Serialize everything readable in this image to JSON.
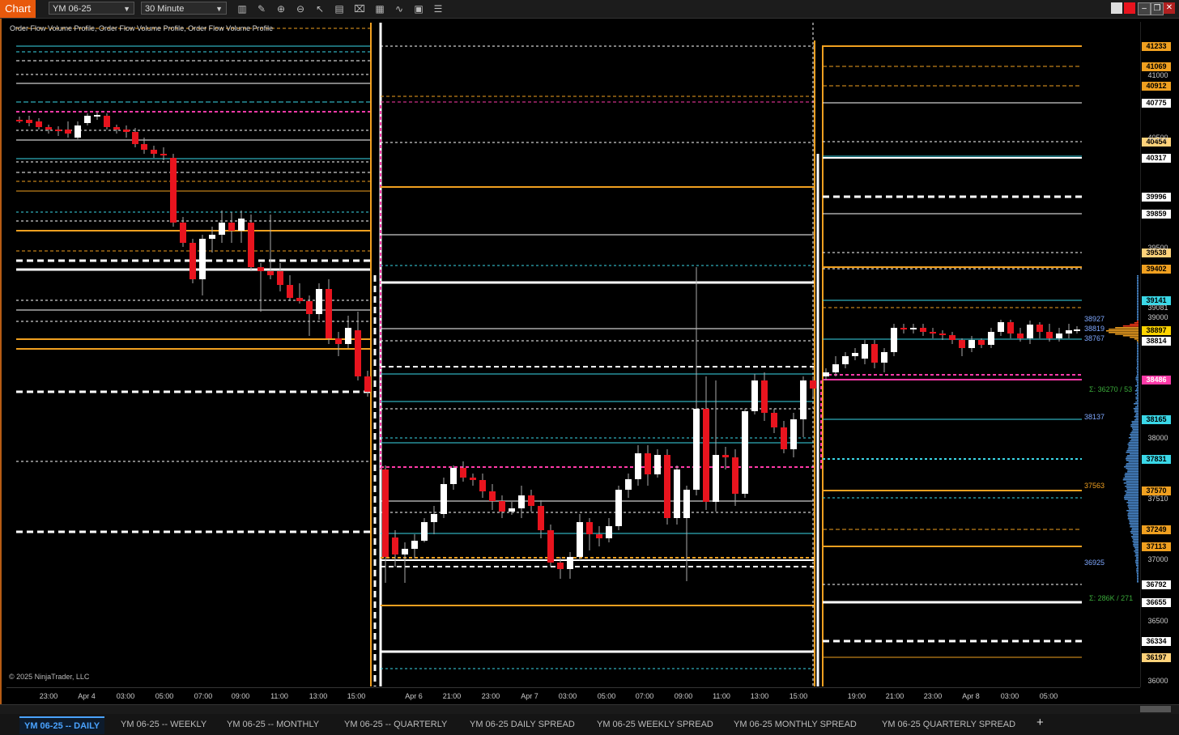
{
  "toolbar": {
    "chart_tab": "Chart",
    "instrument": "YM 06-25",
    "interval": "30 Minute"
  },
  "indicator_label": "Order Flow Volume Profile, Order Flow Volume Profile, Order Flow Volume Profile",
  "f_button": "F",
  "copyright": "© 2025 NinjaTrader, LLC",
  "price_labels": [
    {
      "text": "41233",
      "bg": "#f0a020",
      "fg": "#000"
    },
    {
      "text": "41069",
      "bg": "#f0a020",
      "fg": "#000"
    },
    {
      "text": "40912",
      "bg": "#f0a020",
      "fg": "#000"
    },
    {
      "text": "40775",
      "bg": "#ffffff",
      "fg": "#000"
    },
    {
      "text": "40454",
      "bg": "#ffd27a",
      "fg": "#000"
    },
    {
      "text": "40317",
      "bg": "#ffffff",
      "fg": "#000"
    },
    {
      "text": "39996",
      "bg": "#ffffff",
      "fg": "#000"
    },
    {
      "text": "39859",
      "bg": "#ffffff",
      "fg": "#000"
    },
    {
      "text": "39538",
      "bg": "#ffd27a",
      "fg": "#000"
    },
    {
      "text": "39402",
      "bg": "#f0a020",
      "fg": "#000"
    },
    {
      "text": "39141",
      "bg": "#3ad8e8",
      "fg": "#000"
    },
    {
      "text": "38897",
      "bg": "#ffd400",
      "fg": "#000"
    },
    {
      "text": "38814",
      "bg": "#ffffff",
      "fg": "#000"
    },
    {
      "text": "38486",
      "bg": "#ff3aa8",
      "fg": "#fff"
    },
    {
      "text": "38165",
      "bg": "#3ad8e8",
      "fg": "#000"
    },
    {
      "text": "37831",
      "bg": "#3ad8e8",
      "fg": "#000"
    },
    {
      "text": "37570",
      "bg": "#f0a020",
      "fg": "#000"
    },
    {
      "text": "37249",
      "bg": "#f0a020",
      "fg": "#000"
    },
    {
      "text": "37113",
      "bg": "#f0a020",
      "fg": "#000"
    },
    {
      "text": "36792",
      "bg": "#ffffff",
      "fg": "#000"
    },
    {
      "text": "36655",
      "bg": "#ffffff",
      "fg": "#000"
    },
    {
      "text": "36334",
      "bg": "#ffffff",
      "fg": "#000"
    },
    {
      "text": "36197",
      "bg": "#ffd27a",
      "fg": "#000"
    }
  ],
  "price_ticks": [
    "41000",
    "40500",
    "39500",
    "39081",
    "39000",
    "38000",
    "37510",
    "37000",
    "36500",
    "36000"
  ],
  "side_labels": [
    {
      "text": "38927",
      "color": "#7fa8ff"
    },
    {
      "text": "38819",
      "color": "#7fa8ff"
    },
    {
      "text": "38767",
      "color": "#7fa8ff"
    },
    {
      "text": "38137",
      "color": "#7fa8ff"
    },
    {
      "text": "37563",
      "color": "#f0a020"
    },
    {
      "text": "36925",
      "color": "#7fa8ff"
    },
    {
      "text": "Σ: 36270 / 53",
      "color": "#3aaa3a"
    },
    {
      "text": "Σ: 286K / 271",
      "color": "#3aaa3a"
    }
  ],
  "time_labels": [
    "23:00",
    "Apr 4",
    "03:00",
    "05:00",
    "07:00",
    "09:00",
    "11:00",
    "13:00",
    "15:00",
    "Apr 6",
    "21:00",
    "23:00",
    "Apr 7",
    "03:00",
    "05:00",
    "07:00",
    "09:00",
    "11:00",
    "13:00",
    "15:00",
    "19:00",
    "21:00",
    "23:00",
    "Apr 8",
    "03:00",
    "05:00"
  ],
  "tabs": [
    {
      "label": "YM 06-25 -- DAILY",
      "active": true
    },
    {
      "label": "YM 06-25 -- WEEKLY",
      "active": false
    },
    {
      "label": "YM 06-25 -- MONTHLY",
      "active": false
    },
    {
      "label": "YM 06-25 -- QUARTERLY",
      "active": false
    },
    {
      "label": "YM 06-25 DAILY SPREAD",
      "active": false
    },
    {
      "label": "YM 06-25 WEEKLY SPREAD",
      "active": false
    },
    {
      "label": "YM 06-25 MONTHLY SPREAD",
      "active": false
    },
    {
      "label": "YM 06-25 QUARTERLY SPREAD",
      "active": false
    }
  ],
  "add_tab": "+",
  "colors": {
    "up": "#ffffff",
    "down": "#e8141e",
    "orange": "#f0a020",
    "cyan": "#3ad8e8",
    "magenta": "#ff3aa8",
    "white": "#ffffff"
  }
}
